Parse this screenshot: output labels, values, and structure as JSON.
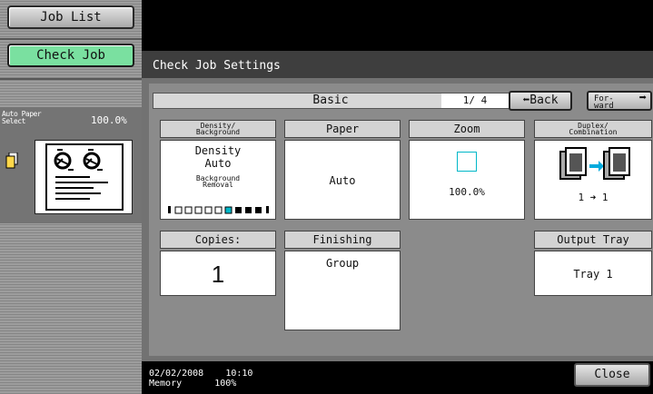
{
  "sidebar": {
    "job_list_label": "Job List",
    "check_job_label": "Check Job",
    "paper_select_label": "Auto Paper Select",
    "paper_select_line1": "Auto Paper",
    "paper_select_line2": "Select",
    "zoom_label": "100.0%"
  },
  "main": {
    "title": "Check Job Settings",
    "tab_label": "Basic",
    "page_indicator": "1/ 4",
    "back_label": "Back",
    "forward_line1": "For-",
    "forward_line2": "ward",
    "density": {
      "header_line1": "Density/",
      "header_line2": "Background",
      "line1": "Density",
      "line2": "Auto",
      "bg_line1": "Background",
      "bg_line2": "Removal",
      "gauge_level": 6,
      "gauge_total": 9
    },
    "paper": {
      "header": "Paper",
      "value": "Auto"
    },
    "zoom": {
      "header": "Zoom",
      "value": "100.0%"
    },
    "duplex": {
      "header_line1": "Duplex/",
      "header_line2": "Combination",
      "value": "1 ➜ 1"
    },
    "copies": {
      "header": "Copies:",
      "value": "1"
    },
    "finishing": {
      "header": "Finishing",
      "value": "Group"
    },
    "output_tray": {
      "header": "Output Tray",
      "value": "Tray 1"
    }
  },
  "footer": {
    "date": "02/02/2008",
    "time": "10:10",
    "memory_label": "Memory",
    "memory_value": "100%",
    "close_label": "Close"
  },
  "colors": {
    "check_job_active": "#7ae0a0",
    "zoom_icon": "#00b7c8"
  }
}
